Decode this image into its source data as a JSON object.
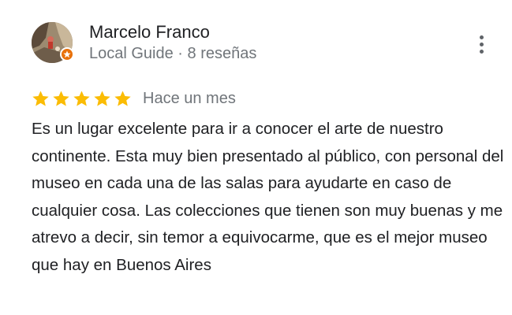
{
  "review": {
    "author": {
      "name": "Marcelo Franco",
      "meta": "Local Guide · 8 reseñas"
    },
    "rating": 5,
    "date": "Hace un mes",
    "text": "Es un lugar excelente para ir a conocer el arte de nuestro continente. Esta muy bien presentado al público, con personal del museo en cada una de las salas para ayudarte en caso de cualquier cosa. Las colecciones que tienen son muy buenas y me atrevo a decir, sin temor a equivocarme, que es el mejor museo que hay en Buenos Aires"
  },
  "colors": {
    "star": "#fbbc04",
    "badge": "#e8710a",
    "secondary_text": "#70757a"
  },
  "icons": {
    "avatar": "profile-photo",
    "badge": "local-guide-badge-icon",
    "menu": "more-vert-icon",
    "star": "star-icon"
  }
}
